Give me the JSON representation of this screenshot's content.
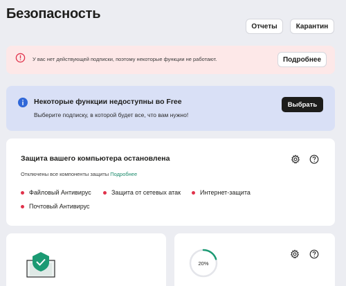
{
  "header": {
    "title": "Безопасность",
    "reports_label": "Отчеты",
    "quarantine_label": "Карантин"
  },
  "alert": {
    "text": "У вас нет действующей подписки, поэтому некоторые функции не работают.",
    "button_label": "Подробнее",
    "icon": "alert-circle-icon",
    "color": "#e0324b"
  },
  "info": {
    "title": "Некоторые функции недоступны во Free",
    "subtitle": "Выберите подписку, в которой будет все, что вам нужно!",
    "button_label": "Выбрать",
    "icon": "info-icon",
    "color": "#2f67d8"
  },
  "protection": {
    "title": "Защита вашего компьютера остановлена",
    "subtitle": "Отключены все компоненты защиты",
    "details_link": "Подробнее",
    "components": [
      "Файловый Антивирус",
      "Защита от сетевых атак",
      "Интернет-защита",
      "Почтовый Антивирус"
    ],
    "status_color": "#e0324b"
  },
  "scan_card": {
    "progress": 0.2,
    "progress_label": "20%",
    "accent_color": "#1b9a73"
  }
}
